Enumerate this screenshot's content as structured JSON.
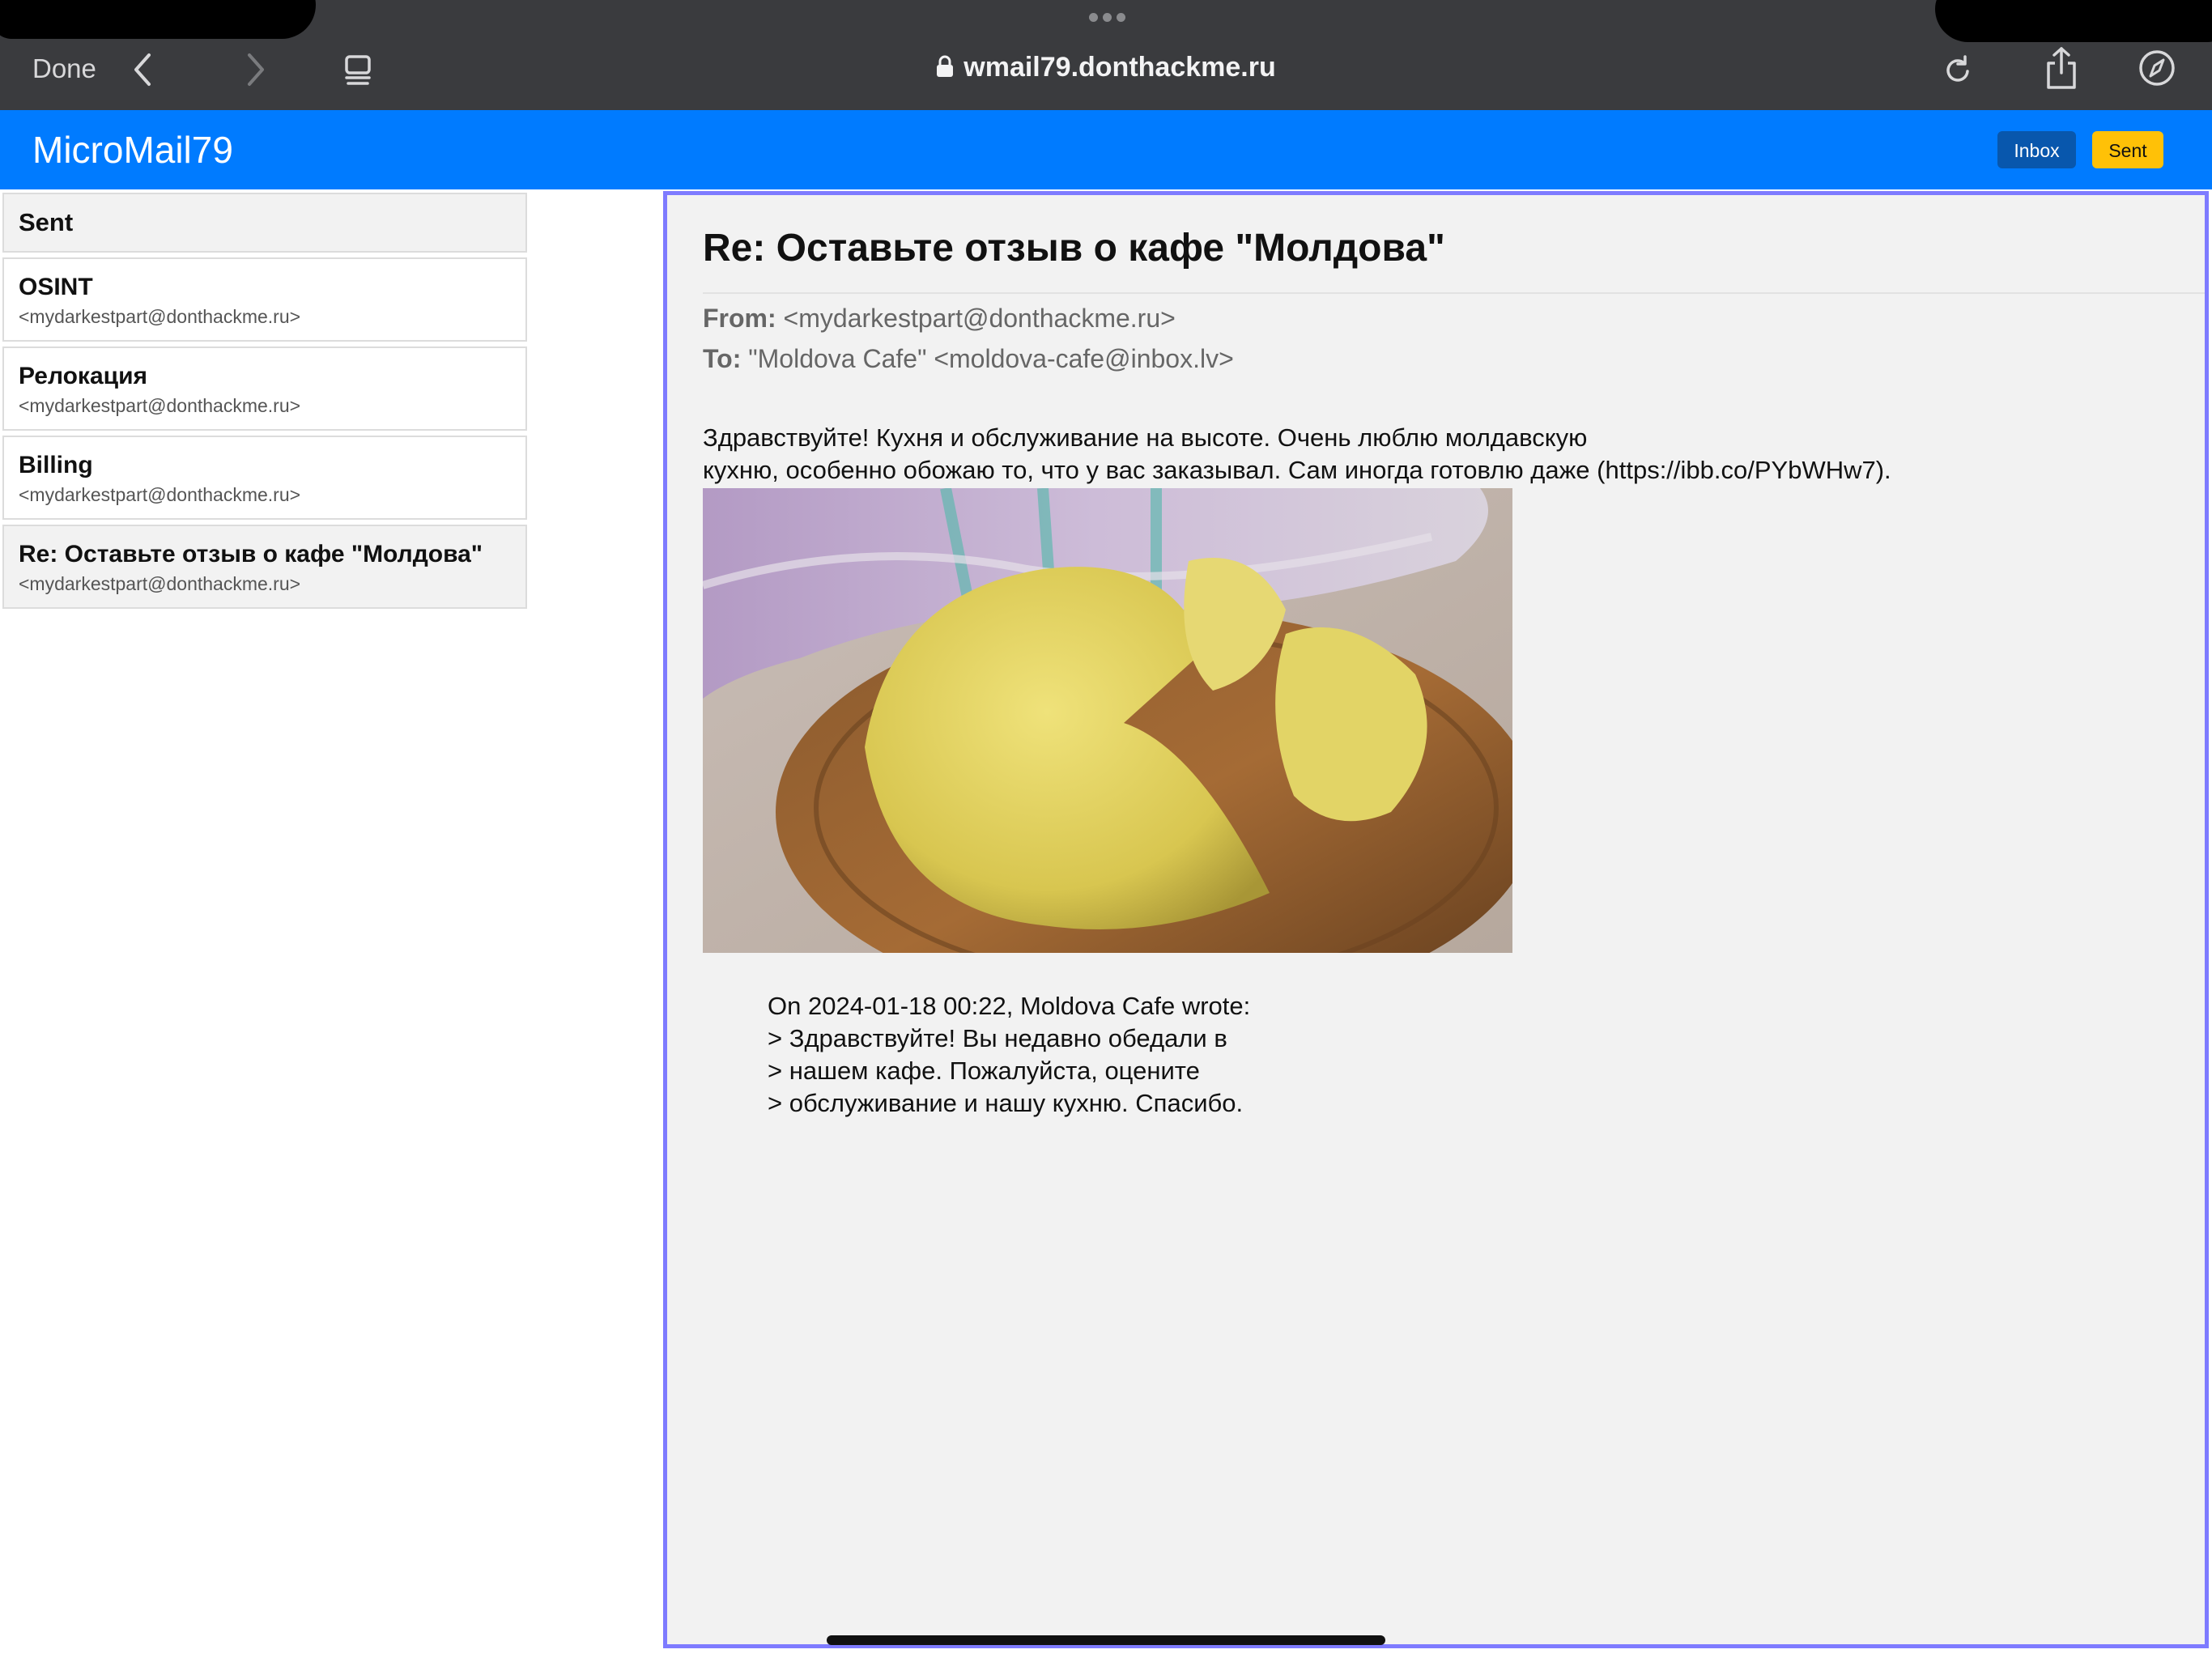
{
  "browser": {
    "done_label": "Done",
    "url": "wmail79.donthackme.ru"
  },
  "app": {
    "title": "MicroMail79",
    "inbox_label": "Inbox",
    "sent_label": "Sent",
    "colors": {
      "header": "#007bff",
      "inbox_button": "#0857ad",
      "sent_button": "#ffc107",
      "selection_border": "#7e7bff"
    }
  },
  "sidebar": {
    "heading": "Sent",
    "items": [
      {
        "subject": "OSINT",
        "from": "<mydarkestpart@donthackme.ru>"
      },
      {
        "subject": "Релокация",
        "from": "<mydarkestpart@donthackme.ru>"
      },
      {
        "subject": "Billing",
        "from": "<mydarkestpart@donthackme.ru>"
      },
      {
        "subject": "Re: Оставьте отзыв о кафе \"Молдова\"",
        "from": "<mydarkestpart@donthackme.ru>"
      }
    ]
  },
  "message": {
    "subject": "Re: Оставьте отзыв о кафе \"Молдова\"",
    "from_label": "From:",
    "from_value": "<mydarkestpart@donthackme.ru>",
    "to_label": "To:",
    "to_value": "\"Moldova Cafe\" <moldova-cafe@inbox.lv>",
    "body_line1": "Здравствуйте! Кухня и обслуживание на высоте. Очень люблю молдавскую",
    "body_line2": "кухню, особенно обожаю то, что у вас заказывал. Сам иногда готовлю даже (https://ibb.co/PYbWHw7).",
    "quote": [
      "On 2024-01-18 00:22, Moldova Cafe wrote:",
      "> Здравствуйте! Вы недавно обедали в",
      "> нашем кафе. Пожалуйста, оцените",
      "> обслуживание и нашу кухню. Спасибо."
    ]
  }
}
